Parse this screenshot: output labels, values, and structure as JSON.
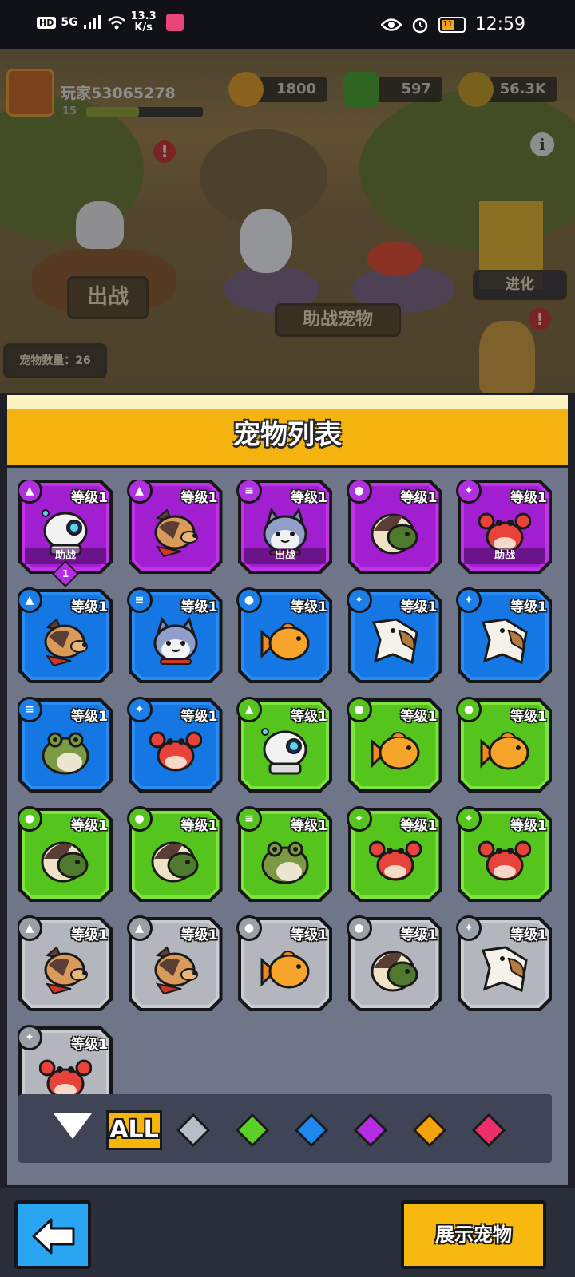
{
  "status_bar": {
    "network": "HD",
    "signal": "5G",
    "speed_value": "13.3",
    "speed_unit": "K/s",
    "battery": "11",
    "time": "12:59"
  },
  "scene": {
    "player_name": "玩家53065278",
    "player_level": "15",
    "xp_progress": 0.45,
    "coins": "1800",
    "gems": "597",
    "energy": "56.3K",
    "deploy_button": "出战",
    "assist_button": "助战宠物",
    "evolve_button": "进化",
    "pet_count": "宠物数量：26"
  },
  "panel": {
    "title": "宠物列表"
  },
  "pets": [
    {
      "rarity": "purple",
      "pet": "robot",
      "level": "等级1",
      "type_icon": "wolf-icon",
      "status": "助战",
      "star": "1"
    },
    {
      "rarity": "purple",
      "pet": "dog",
      "level": "等级1",
      "type_icon": "wolf-icon",
      "status": ""
    },
    {
      "rarity": "purple",
      "pet": "cat",
      "level": "等级1",
      "type_icon": "stack-icon",
      "status": "出战"
    },
    {
      "rarity": "purple",
      "pet": "turtle",
      "level": "等级1",
      "type_icon": "turtle-icon",
      "status": ""
    },
    {
      "rarity": "purple",
      "pet": "crab",
      "level": "等级1",
      "type_icon": "eagle-icon",
      "status": "助战"
    },
    {
      "rarity": "blue",
      "pet": "dog",
      "level": "等级1",
      "type_icon": "wolf-icon",
      "status": ""
    },
    {
      "rarity": "blue",
      "pet": "cat",
      "level": "等级1",
      "type_icon": "stack-icon",
      "status": ""
    },
    {
      "rarity": "blue",
      "pet": "fish",
      "level": "等级1",
      "type_icon": "turtle-icon",
      "status": ""
    },
    {
      "rarity": "blue",
      "pet": "eagle",
      "level": "等级1",
      "type_icon": "eagle-icon",
      "status": ""
    },
    {
      "rarity": "blue",
      "pet": "eagle",
      "level": "等级1",
      "type_icon": "eagle-icon",
      "status": ""
    },
    {
      "rarity": "blue",
      "pet": "frog",
      "level": "等级1",
      "type_icon": "stack-icon",
      "status": ""
    },
    {
      "rarity": "blue",
      "pet": "crab",
      "level": "等级1",
      "type_icon": "eagle-icon",
      "status": ""
    },
    {
      "rarity": "green",
      "pet": "robot",
      "level": "等级1",
      "type_icon": "wolf-icon",
      "status": ""
    },
    {
      "rarity": "green",
      "pet": "fish",
      "level": "等级1",
      "type_icon": "turtle-icon",
      "status": ""
    },
    {
      "rarity": "green",
      "pet": "fish",
      "level": "等级1",
      "type_icon": "turtle-icon",
      "status": ""
    },
    {
      "rarity": "green",
      "pet": "turtle",
      "level": "等级1",
      "type_icon": "turtle-icon",
      "status": ""
    },
    {
      "rarity": "green",
      "pet": "turtle",
      "level": "等级1",
      "type_icon": "turtle-icon",
      "status": ""
    },
    {
      "rarity": "green",
      "pet": "frog",
      "level": "等级1",
      "type_icon": "stack-icon",
      "status": ""
    },
    {
      "rarity": "green",
      "pet": "crab",
      "level": "等级1",
      "type_icon": "eagle-icon",
      "status": ""
    },
    {
      "rarity": "green",
      "pet": "crab",
      "level": "等级1",
      "type_icon": "eagle-icon",
      "status": ""
    },
    {
      "rarity": "grey",
      "pet": "dog",
      "level": "等级1",
      "type_icon": "wolf-icon",
      "status": ""
    },
    {
      "rarity": "grey",
      "pet": "dog",
      "level": "等级1",
      "type_icon": "wolf-icon",
      "status": ""
    },
    {
      "rarity": "grey",
      "pet": "fish",
      "level": "等级1",
      "type_icon": "turtle-icon",
      "status": ""
    },
    {
      "rarity": "grey",
      "pet": "turtle",
      "level": "等级1",
      "type_icon": "turtle-icon",
      "status": ""
    },
    {
      "rarity": "grey",
      "pet": "eagle",
      "level": "等级1",
      "type_icon": "eagle-icon",
      "status": ""
    },
    {
      "rarity": "grey",
      "pet": "crab",
      "level": "等级1",
      "type_icon": "eagle-icon",
      "status": ""
    }
  ],
  "filters": {
    "sort_icon": "triangle-down-icon",
    "all_label": "ALL",
    "gems": [
      {
        "name": "grey",
        "color": "#b8bcc6"
      },
      {
        "name": "green",
        "color": "#5ad126"
      },
      {
        "name": "blue",
        "color": "#1f86ee"
      },
      {
        "name": "purple",
        "color": "#b52ce4"
      },
      {
        "name": "orange",
        "color": "#f5a20c"
      },
      {
        "name": "red",
        "color": "#ee2e6a"
      }
    ]
  },
  "bottom": {
    "back_icon": "arrow-left-icon",
    "show_button": "展示宠物"
  },
  "colors": {
    "header": "#f4b30f",
    "panel": "#6f7689",
    "back_button": "#2aa5f2",
    "show_button": "#f7b90f"
  }
}
